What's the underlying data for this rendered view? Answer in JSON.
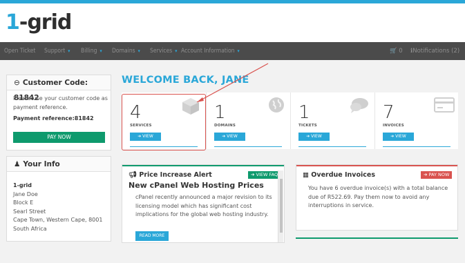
{
  "logo": {
    "num": "1",
    "rest": "-grid"
  },
  "nav": {
    "items": [
      {
        "label": "Open Ticket",
        "caret": false
      },
      {
        "label": "Support",
        "caret": true
      },
      {
        "label": "Billing",
        "caret": true
      },
      {
        "label": "Domains",
        "caret": true
      },
      {
        "label": "Services",
        "caret": true
      },
      {
        "label": "Account Information",
        "caret": true
      }
    ],
    "cart_count": "0",
    "notifications": "Notifications (2)"
  },
  "customer": {
    "title": "Customer Code: 81842",
    "description": "Please use your customer code as payment reference.",
    "payment_reference": "Payment reference:81842",
    "pay_now": "PAY NOW"
  },
  "your_info": {
    "title": "Your Info",
    "company": "1-grid",
    "name": "Jane Doe",
    "address1": "Block E",
    "address2": "Searl Street",
    "address3": "Cape Town, Western Cape, 8001",
    "country": "South Africa"
  },
  "welcome": "WELCOME BACK, JANE",
  "stats": [
    {
      "count": "4",
      "label": "SERVICES",
      "button": "➔ VIEW",
      "icon": "box-icon"
    },
    {
      "count": "1",
      "label": "DOMAINS",
      "button": "➔ VIEW",
      "icon": "globe-icon"
    },
    {
      "count": "1",
      "label": "TICKETS",
      "button": "➔ VIEW",
      "icon": "chat-icon"
    },
    {
      "count": "7",
      "label": "INVOICES",
      "button": "➔ VIEW",
      "icon": "card-icon"
    }
  ],
  "announcement": {
    "header": "Price Increase Alert",
    "tag": "➔ VIEW FAQ",
    "title": "New cPanel Web Hosting Prices",
    "body": "cPanel recently announced a major revision to its licensing model which has significant cost implications for the global web hosting industry.",
    "read_more": "READ MORE"
  },
  "overdue": {
    "title": "Overdue Invoices",
    "tag": "➔ PAY NOW",
    "body": "You have 6 overdue invoice(s) with a total balance due of R522.69. Pay them now to avoid any interruptions in service."
  },
  "colors": {
    "accent": "#2aa7d8",
    "green": "#0e9a6d",
    "red": "#d9534f",
    "nav_bg": "#4b4b4b"
  }
}
